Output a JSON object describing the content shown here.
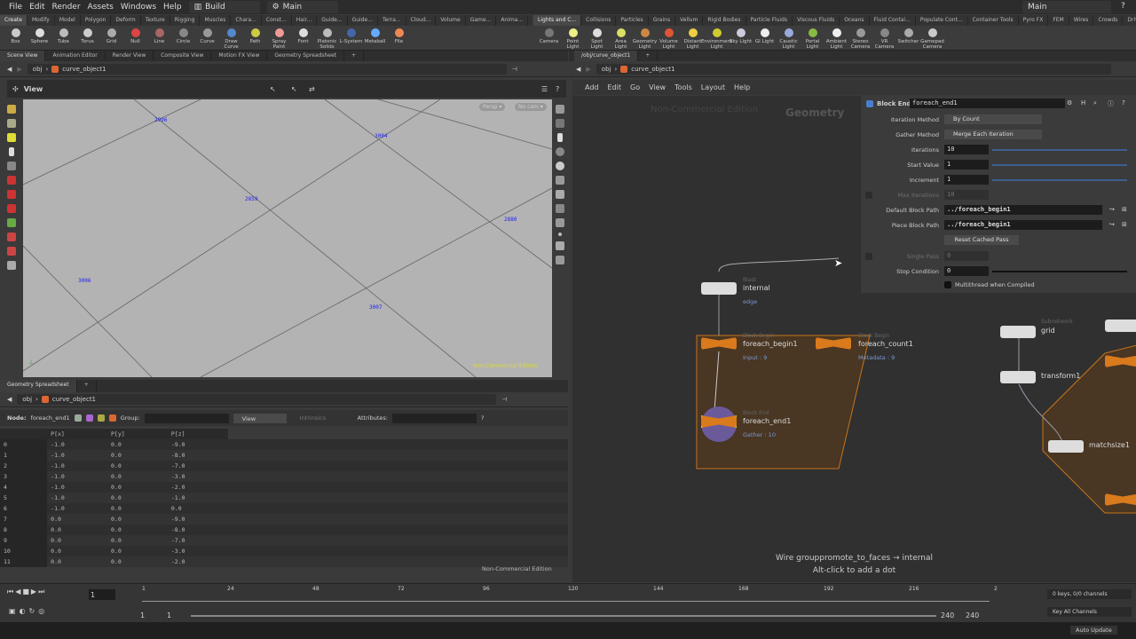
{
  "menubar": {
    "items": [
      "File",
      "Edit",
      "Render",
      "Assets",
      "Windows",
      "Help"
    ],
    "desktop_left": "Build",
    "desktop_right": "Main",
    "desktop_main": "Main"
  },
  "shelf_left": {
    "tabs": [
      "Create",
      "Modify",
      "Model",
      "Polygon",
      "Deform",
      "Texture",
      "Rigging",
      "Muscles",
      "Chara...",
      "Const...",
      "Hair...",
      "Guide...",
      "Guide...",
      "Terra...",
      "Cloud...",
      "Volume",
      "Game...",
      "Anima..."
    ],
    "tools": [
      {
        "label": "Box",
        "color": "#c9c9c9"
      },
      {
        "label": "Sphere",
        "color": "#ddd"
      },
      {
        "label": "Tube",
        "color": "#bbb"
      },
      {
        "label": "Torus",
        "color": "#ccc"
      },
      {
        "label": "Grid",
        "color": "#aaa"
      },
      {
        "label": "Null",
        "color": "#d44"
      },
      {
        "label": "Line",
        "color": "#a66"
      },
      {
        "label": "Circle",
        "color": "#888"
      },
      {
        "label": "Curve",
        "color": "#999"
      },
      {
        "label": "Draw Curve",
        "color": "#58c"
      },
      {
        "label": "Path",
        "color": "#cc4"
      },
      {
        "label": "Spray Paint",
        "color": "#e99"
      },
      {
        "label": "Font",
        "color": "#ddd"
      },
      {
        "label": "Platonic Solids",
        "color": "#bbb"
      },
      {
        "label": "L-System",
        "color": "#46a"
      },
      {
        "label": "Metaball",
        "color": "#6af"
      },
      {
        "label": "File",
        "color": "#e85"
      }
    ]
  },
  "shelf_right": {
    "tabs": [
      "Lights and C...",
      "Collisions",
      "Particles",
      "Grains",
      "Vellum",
      "Rigid Bodies",
      "Particle Fluids",
      "Viscous Fluids",
      "Oceans",
      "Fluid Contai...",
      "Populate Cont...",
      "Container Tools",
      "Pyro FX",
      "FEM",
      "Wires",
      "Crowds",
      "Drive Simula..."
    ],
    "tools": [
      {
        "label": "Camera",
        "color": "#777"
      },
      {
        "label": "Point Light",
        "color": "#ee8"
      },
      {
        "label": "Spot Light",
        "color": "#ddd"
      },
      {
        "label": "Area Light",
        "color": "#dd6"
      },
      {
        "label": "Geometry Light",
        "color": "#c84"
      },
      {
        "label": "Volume Light",
        "color": "#d53"
      },
      {
        "label": "Distant Light",
        "color": "#ec4"
      },
      {
        "label": "Environment Light",
        "color": "#cc3"
      },
      {
        "label": "Sky Light",
        "color": "#ccd"
      },
      {
        "label": "GI Light",
        "color": "#eee"
      },
      {
        "label": "Caustic Light",
        "color": "#9ad"
      },
      {
        "label": "Portal Light",
        "color": "#8b4"
      },
      {
        "label": "Ambient Light",
        "color": "#eee"
      },
      {
        "label": "Stereo Camera",
        "color": "#999"
      },
      {
        "label": "VR Camera",
        "color": "#888"
      },
      {
        "label": "Switcher",
        "color": "#aaa"
      },
      {
        "label": "Gamepad Camera",
        "color": "#ccc"
      }
    ]
  },
  "left_pane_tabs": [
    "Scene View",
    "Animation Editor",
    "Render View",
    "Composite View",
    "Motion FX View",
    "Geometry Spreadsheet"
  ],
  "right_pane_tabs": [
    "/obj/curve_object1"
  ],
  "viewport": {
    "path_root": "obj",
    "path_node": "curve_object1",
    "toolbar_title": "View",
    "persp": "Persp",
    "cam": "No cam",
    "watermark": "Non-Commercial Edition",
    "point_labels": [
      "2996",
      "3004",
      "2859",
      "2880",
      "3006",
      "3007"
    ]
  },
  "spreadsheet": {
    "tab": "Geometry Spreadsheet",
    "path_root": "obj",
    "path_node": "curve_object1",
    "node_label": "Node:",
    "node": "foreach_end1",
    "group_label": "Group:",
    "view": "View",
    "intrinsics": "Intrinsics",
    "attributes_label": "Attributes:",
    "columns": [
      "",
      "P[x]",
      "P[y]",
      "P[z]"
    ],
    "rows": [
      [
        "0",
        "-1.0",
        "0.0",
        "-9.0"
      ],
      [
        "1",
        "-1.0",
        "0.0",
        "-8.0"
      ],
      [
        "2",
        "-1.0",
        "0.0",
        "-7.0"
      ],
      [
        "3",
        "-1.0",
        "0.0",
        "-3.0"
      ],
      [
        "4",
        "-1.0",
        "0.0",
        "-2.0"
      ],
      [
        "5",
        "-1.0",
        "0.0",
        "-1.0"
      ],
      [
        "6",
        "-1.0",
        "0.0",
        "0.0"
      ],
      [
        "7",
        "0.0",
        "0.0",
        "-9.0"
      ],
      [
        "8",
        "0.0",
        "0.0",
        "-8.0"
      ],
      [
        "9",
        "0.0",
        "0.0",
        "-7.0"
      ],
      [
        "10",
        "0.0",
        "0.0",
        "-3.0"
      ],
      [
        "11",
        "0.0",
        "0.0",
        "-2.0"
      ]
    ],
    "watermark": "Non-Commercial Edition"
  },
  "network": {
    "path_root": "obj",
    "path_node": "curve_object1",
    "menu": [
      "Add",
      "Edit",
      "Go",
      "View",
      "Tools",
      "Layout",
      "Help"
    ],
    "watermark": "Non-Commercial Edition",
    "context": "Geometry",
    "nodes": {
      "internal": {
        "type": "Blast",
        "name": "internal",
        "info": "edge"
      },
      "begin": {
        "type": "Block Begin",
        "name": "foreach_begin1",
        "info": "Input : 9"
      },
      "count": {
        "type": "Block Begin",
        "name": "foreach_count1",
        "info": "Metadata : 9"
      },
      "end": {
        "type": "Block End",
        "name": "foreach_end1",
        "info": "Gather : 10"
      },
      "grid": {
        "type": "Subnetwork",
        "name": "grid"
      },
      "transform": {
        "name": "transform1"
      },
      "matchsize": {
        "name": "matchsize1"
      }
    },
    "hint_line1": "Wire grouppromote_to_faces → internal",
    "hint_line2": "Alt-click to add a dot"
  },
  "params": {
    "node_type": "Block End",
    "node_name": "foreach_end1",
    "iteration_method_label": "Iteration Method",
    "iteration_method": "By Count",
    "gather_method_label": "Gather Method",
    "gather_method": "Merge Each Iteration",
    "iterations_label": "Iterations",
    "iterations": "10",
    "start_value_label": "Start Value",
    "start_value": "1",
    "increment_label": "Increment",
    "increment": "1",
    "max_iterations_label": "Max Iterations",
    "max_iterations": "10",
    "default_block_path_label": "Default Block Path",
    "default_block_path": "../foreach_begin1",
    "piece_block_path_label": "Piece Block Path",
    "piece_block_path": "../foreach_begin1",
    "reset_cached_pass": "Reset Cached Pass",
    "single_pass_label": "Single Pass",
    "single_pass": "0",
    "stop_condition_label": "Stop Condition",
    "stop_condition": "0",
    "multithread_label": "Multithread when Compiled"
  },
  "timeline": {
    "current_frame": "1",
    "ticks": [
      "1",
      "24",
      "48",
      "72",
      "96",
      "120",
      "144",
      "168",
      "192",
      "216",
      "2"
    ],
    "range_start": "1",
    "range_start2": "1",
    "range_end": "240",
    "range_end2": "240",
    "keys_info": "0 keys, 0/0 channels",
    "key_all": "Key All Channels"
  },
  "status": {
    "auto_update": "Auto Update"
  },
  "colors": {
    "accent": "#d97a1c",
    "viewport": "#b3b3b3",
    "label_blue": "#2222ee"
  }
}
